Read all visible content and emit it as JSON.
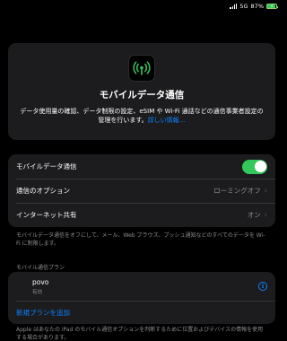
{
  "status_bar": {
    "network": "5G",
    "battery_percent": "87%",
    "battery_level": 0.87
  },
  "hero": {
    "icon": "antenna-signal-icon",
    "title": "モバイルデータ通信",
    "description": "データ使用量の確認、データ制限の設定、eSIM や Wi-Fi 通話などの通信事業者設定の管理を行います。",
    "link": "詳しい情報…"
  },
  "settings": {
    "mobile_data_label": "モバイルデータ通信",
    "mobile_data_on": true,
    "options_label": "通信のオプション",
    "options_value": "ローミングオフ",
    "hotspot_label": "インターネット共有",
    "hotspot_value": "オン"
  },
  "footnote_data": "モバイルデータ通信をオフにして、メール、Web ブラウズ、プッシュ通知などのすべてのデータを Wi-Fi に制限します。",
  "plans": {
    "header": "モバイル通信プラン",
    "items": [
      {
        "name": "povo",
        "status": "有効"
      }
    ],
    "add_label": "新規プランを追加"
  },
  "footnote_plans": "Apple はあなたの iPad のモバイル通信オプションを判断するために位置およびデバイスの情報を使用する場合があります。",
  "colors": {
    "accent": "#0a84ff",
    "toggle_on": "#34c759",
    "background": "#000000",
    "card": "#1c1c1e"
  }
}
